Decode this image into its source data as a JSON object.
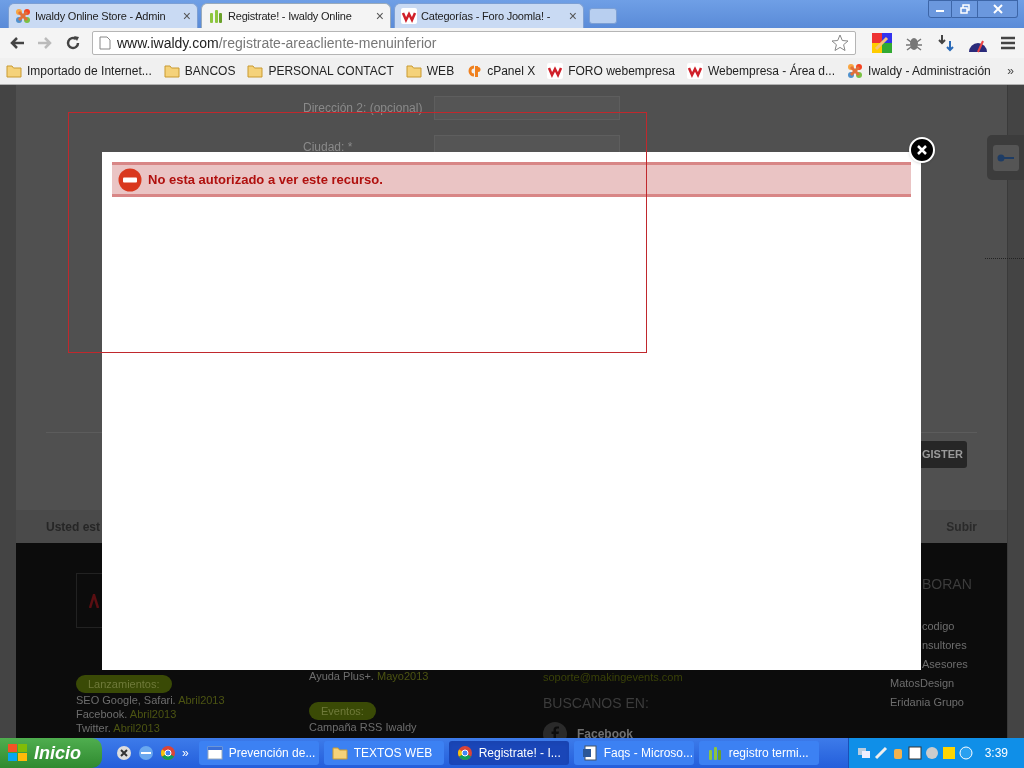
{
  "browser": {
    "tabs": [
      {
        "title": "Iwaldy Online Store - Admin",
        "kind": "joomla",
        "selected": false
      },
      {
        "title": "Registrate! - Iwaldy Online",
        "kind": "iwaldy",
        "selected": true
      },
      {
        "title": "Categorías - Foro Joomla! -",
        "kind": "webempresa",
        "selected": false
      }
    ],
    "tab_close": "×",
    "url": {
      "host": "www.iwaldy.com",
      "path": "/registrate-areacliente-menuinferior"
    },
    "bookmarks": [
      {
        "label": "Importado de Internet...",
        "kind": "folder"
      },
      {
        "label": "BANCOS",
        "kind": "folder"
      },
      {
        "label": "PERSONAL CONTACT",
        "kind": "folder"
      },
      {
        "label": "WEB",
        "kind": "folder"
      },
      {
        "label": "cPanel X",
        "kind": "cpanel"
      },
      {
        "label": "FORO webempresa",
        "kind": "webempresa"
      },
      {
        "label": "Webempresa - Área d...",
        "kind": "webempresa"
      },
      {
        "label": "Iwaldy - Administración",
        "kind": "joomla"
      }
    ],
    "more": "»"
  },
  "page": {
    "form": [
      {
        "label": "Dirección 2: (opcional)"
      },
      {
        "label": "Ciudad: *"
      }
    ],
    "register_button": "GISTER",
    "breadcrumb": "Usted est",
    "back_to_top": "Subir",
    "footer": {
      "col1": {
        "badge": "Lanzamientos:",
        "lines": [
          {
            "text": "SEO Google, Safari.",
            "date": "Abril2013"
          },
          {
            "text": "Facebook.",
            "date": "Abril2013"
          },
          {
            "text": "Twitter.",
            "date": "Abril2013"
          }
        ]
      },
      "col2": {
        "lines": [
          {
            "text": "Ayuda Plus+.",
            "date": "Mayo2013"
          }
        ],
        "badge": "Eventos:",
        "after": "Campaña RSS Iwaldy"
      },
      "col3": {
        "email": "soporte@makingevents.com",
        "heading": "BUSCANOS EN:",
        "social": "Facebook"
      },
      "col4": {
        "heading": "BORAN",
        "links": [
          "codigo",
          "nsultores",
          "Asesores",
          "MatosDesign",
          "Eridania Grupo"
        ]
      }
    }
  },
  "modal": {
    "message": "No esta autorizado a ver este recurso."
  },
  "taskbar": {
    "start": "Inicio",
    "quick_more": "»",
    "tasks": [
      {
        "label": "Prevención de...",
        "kind": "window",
        "selected": false
      },
      {
        "label": "TEXTOS WEB",
        "kind": "folder",
        "selected": false
      },
      {
        "label": "Registrate! - I...",
        "kind": "chrome",
        "selected": true
      },
      {
        "label": "Faqs - Microso...",
        "kind": "word",
        "selected": false
      },
      {
        "label": "registro termi...",
        "kind": "iwaldy",
        "selected": false
      }
    ],
    "clock": "3:39"
  }
}
